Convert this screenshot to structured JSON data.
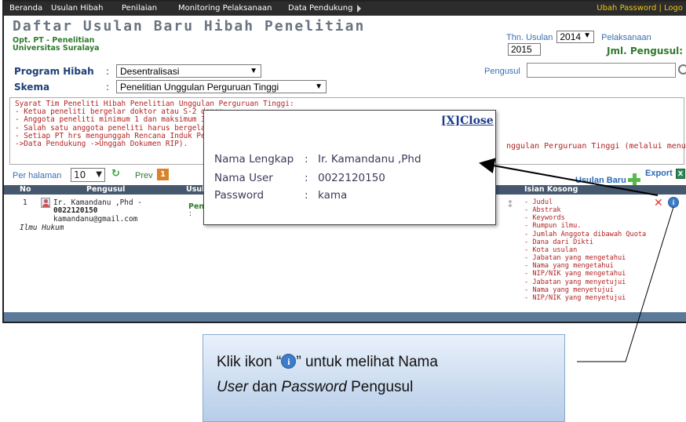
{
  "menu": {
    "items": [
      "Beranda",
      "Usulan Hibah",
      "Penilaian",
      "Monitoring Pelaksanaan",
      "Data Pendukung"
    ],
    "right": "Ubah Password | Logo"
  },
  "header": {
    "title": "Daftar Usulan Baru Hibah Penelitian",
    "org_line1": "Opt. PT - Penelitian",
    "org_line2": "Universitas Suralaya",
    "thn_label": "Thn. Usulan",
    "thn_value": "2014",
    "pelaksanaan_label": "Pelaksanaan",
    "pelaksanaan_value": "2015",
    "jml_label": "Jml. Pengusul:"
  },
  "filters": {
    "program_label": "Program Hibah",
    "program_value": "Desentralisasi",
    "skema_label": "Skema",
    "skema_value": "Penelitian Unggulan Perguruan Tinggi",
    "pengusul_label": "Pengusul"
  },
  "notice": {
    "lines": [
      "Syarat Tim Peneliti Hibah Penelitian Unggulan Perguruan Tinggi:",
      "- Ketua peneliti bergelar doktor atau S-2 denga",
      "- Anggota peneliti minimum 1 dan maksimum 3",
      "- Salah satu anggota peneliti harus bergelar do",
      "- Setiap PT hrs mengunggah Rencana Induk Pe",
      "->Data Pendukung ->Unggah Dokumen RIP)."
    ],
    "tail": "nggulan Perguruan Tinggi (melalui menu:"
  },
  "toolbar": {
    "per_halaman": "Per halaman",
    "per_value": "10",
    "prev": "Prev",
    "page": "1",
    "usulan_baru": "Usulan Baru",
    "export": "Export"
  },
  "table": {
    "headers": {
      "no": "No",
      "pengusul": "Pengusul",
      "usulan": "Usulan",
      "isian": "Isian Kosong"
    },
    "row": {
      "no": "1",
      "name": "Ir. Kamandanu ,Phd -",
      "nip": "0022120150",
      "email": "kamandanu@gmail.com",
      "dept": "Ilmu Hukum",
      "usulan": "Penelit",
      "colon": ":",
      "isian": [
        "- Judul",
        "- Abstrak",
        "- Keywords",
        "- Rumpun ilmu.",
        "- Jumlah Anggota dibawah Quota",
        "- Dana dari Dikti",
        "- Kota usulan",
        "- Jabatan yang mengetahui",
        "- Nama yang mengetahui",
        "- NIP/NIK yang mengetahui",
        "- Jabatan yang menyetujui",
        "- Nama yang menyetujui",
        "- NIP/NIK yang menyetujui"
      ]
    }
  },
  "popup": {
    "close": "[X]Close",
    "rows": [
      {
        "key": "Nama Lengkap",
        "sep": ":",
        "value": "Ir. Kamandanu ,Phd"
      },
      {
        "key": "Nama User",
        "sep": ":",
        "value": "0022120150"
      },
      {
        "key": "Password",
        "sep": ":",
        "value": "kama"
      }
    ]
  },
  "callout": {
    "line1_pre": "Klik ikon “",
    "line1_post": "” untuk melihat Nama",
    "line2_user": "User",
    "line2_mid": " dan ",
    "line2_password": "Password",
    "line2_end": " Pengusul"
  },
  "icons": {
    "info": "i",
    "excel": "X",
    "refresh": "↻",
    "pdf": "↕"
  }
}
